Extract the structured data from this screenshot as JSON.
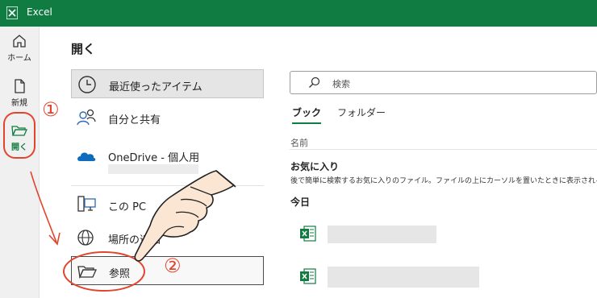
{
  "app": {
    "name": "Excel"
  },
  "nav": [
    {
      "label": "ホーム",
      "icon": "home-icon"
    },
    {
      "label": "新規",
      "icon": "new-document-icon"
    },
    {
      "label": "開く",
      "icon": "open-folder-icon",
      "selected": true
    }
  ],
  "page": {
    "title": "開く"
  },
  "locations": [
    {
      "label": "最近使ったアイテム",
      "icon": "clock-icon",
      "selected": true
    },
    {
      "label": "自分と共有",
      "icon": "shared-people-icon"
    },
    {
      "label": "OneDrive - 個人用",
      "icon": "onedrive-cloud-icon"
    },
    {
      "label": "この PC",
      "icon": "pc-icon"
    },
    {
      "label": "場所の追加",
      "icon": "globe-add-icon"
    },
    {
      "label": "参照",
      "icon": "browse-folder-icon"
    }
  ],
  "search": {
    "placeholder": "検索"
  },
  "tabs": [
    {
      "label": "ブック",
      "active": true
    },
    {
      "label": "フォルダー"
    }
  ],
  "list": {
    "column_name": "名前",
    "favorites_title": "お気に入り",
    "favorites_desc": "後で簡単に検索するお気に入りのファイル。ファイルの上にカーソルを置いたときに表示されるstar",
    "today_label": "今日"
  },
  "annotations": {
    "step1": "①",
    "step2": "②"
  },
  "colors": {
    "brand": "#107c41",
    "annotation": "#e2452e"
  }
}
